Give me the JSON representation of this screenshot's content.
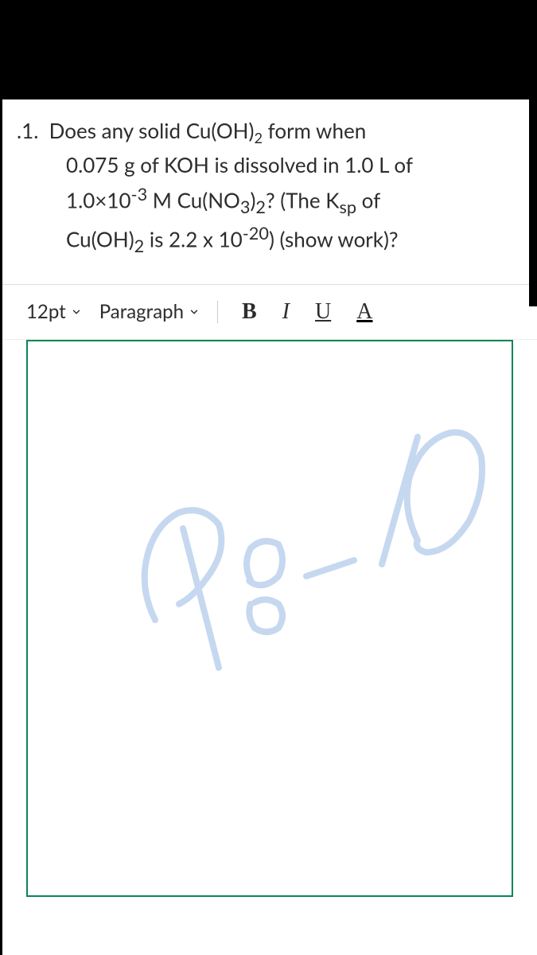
{
  "question": {
    "number": ".1.",
    "line1_part1": "Does any solid Cu(OH)",
    "line1_sub1": "2",
    "line1_part2": " form when",
    "line2_part1": "0.075 g of KOH is dissolved in 1.0 L of",
    "line3_part1": "1.0×10",
    "line3_sup1": "-3",
    "line3_part2": " M Cu(NO",
    "line3_sub1": "3",
    "line3_part3": ")",
    "line3_sub2": "2",
    "line3_part4": "? (The K",
    "line3_sub3": "sp",
    "line3_part5": " of",
    "line4_part1": "Cu(OH)",
    "line4_sub1": "2",
    "line4_part2": " is 2.2 x 10",
    "line4_sup1": "-20",
    "line4_part3": ") (show work)?"
  },
  "toolbar": {
    "font_size": "12pt",
    "paragraph": "Paragraph",
    "bold": "B",
    "italic": "I",
    "underline": "U",
    "text_color": "A"
  }
}
